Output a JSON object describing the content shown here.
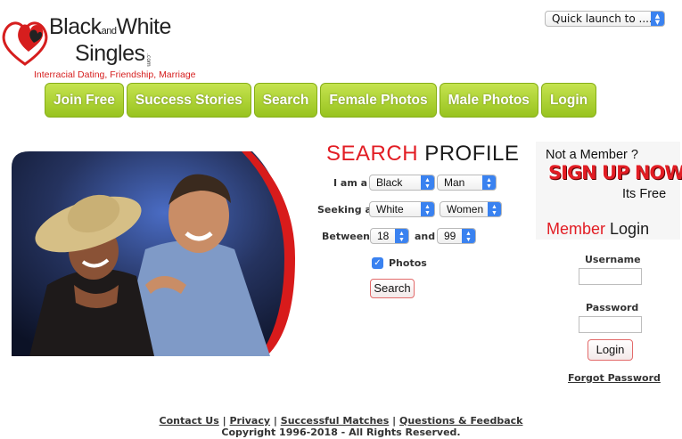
{
  "logo": {
    "name_first": "Black",
    "name_and": "and",
    "name_second": "White",
    "name_singles": "Singles",
    "name_com": ".com",
    "tagline": "Interracial Dating, Friendship, Marriage",
    "heart_color": "#d61e1e"
  },
  "quick_launch": {
    "value": "Quick launch to ...."
  },
  "nav": {
    "items": [
      {
        "label": "Join Free"
      },
      {
        "label": "Success Stories"
      },
      {
        "label": "Search"
      },
      {
        "label": "Female Photos"
      },
      {
        "label": "Male Photos"
      },
      {
        "label": "Login"
      }
    ],
    "color": "#a9cf2c"
  },
  "search_profile": {
    "title_red": "SEARCH",
    "title_black": "PROFILE",
    "i_am_label": "I am a",
    "i_am_race": "Black",
    "i_am_gender": "Man",
    "seeking_label": "Seeking a",
    "seeking_race": "White",
    "seeking_gender": "Women",
    "between_label": "Between",
    "age_min": "18",
    "and_label": "and",
    "age_max": "99",
    "photos_label": "Photos",
    "photos_checked": true,
    "search_button": "Search"
  },
  "member": {
    "not_member": "Not a Member ?",
    "signup": "SIGN UP NOW",
    "its_free": "Its Free",
    "login_title_red": "Member",
    "login_title_black": "Login",
    "username_label": "Username",
    "username_value": "",
    "password_label": "Password",
    "password_value": "",
    "login_button": "Login",
    "forgot_password": "Forgot Password"
  },
  "footer": {
    "links": [
      {
        "label": "Contact Us"
      },
      {
        "label": "Privacy"
      },
      {
        "label": "Successful Matches"
      },
      {
        "label": "Questions & Feedback"
      }
    ],
    "separator": "|",
    "copyright": "Copyright 1996-2018 - All Rights Reserved."
  },
  "colors": {
    "accent_red": "#e21d24",
    "nav_green": "#a9cf2c",
    "select_arrow_blue": "#3a82f0"
  }
}
